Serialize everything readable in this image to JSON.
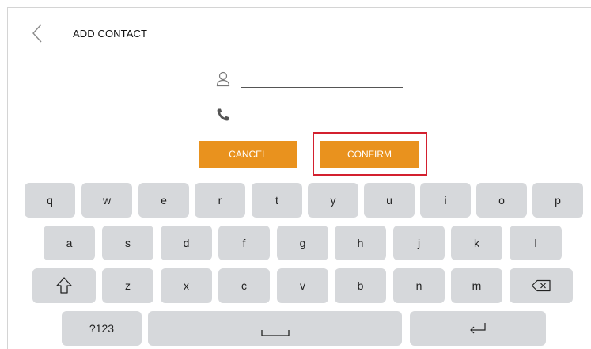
{
  "header": {
    "title": "ADD CONTACT",
    "back_icon": "chevron-left-icon"
  },
  "form": {
    "name_field": {
      "icon": "person-icon",
      "value": ""
    },
    "phone_field": {
      "icon": "phone-icon",
      "value": ""
    }
  },
  "buttons": {
    "cancel_label": "CANCEL",
    "confirm_label": "CONFIRM"
  },
  "colors": {
    "accent": "#e9921e",
    "highlight": "#d3202f",
    "key_bg": "#d6d8db"
  },
  "keyboard": {
    "row1": [
      "q",
      "w",
      "e",
      "r",
      "t",
      "y",
      "u",
      "i",
      "o",
      "p"
    ],
    "row2": [
      "a",
      "s",
      "d",
      "f",
      "g",
      "h",
      "j",
      "k",
      "l"
    ],
    "row3": [
      "z",
      "x",
      "c",
      "v",
      "b",
      "n",
      "m"
    ],
    "shift_icon": "shift-icon",
    "backspace_icon": "backspace-icon",
    "numbers_label": "?123",
    "space_icon": "space-icon",
    "enter_icon": "enter-icon"
  }
}
